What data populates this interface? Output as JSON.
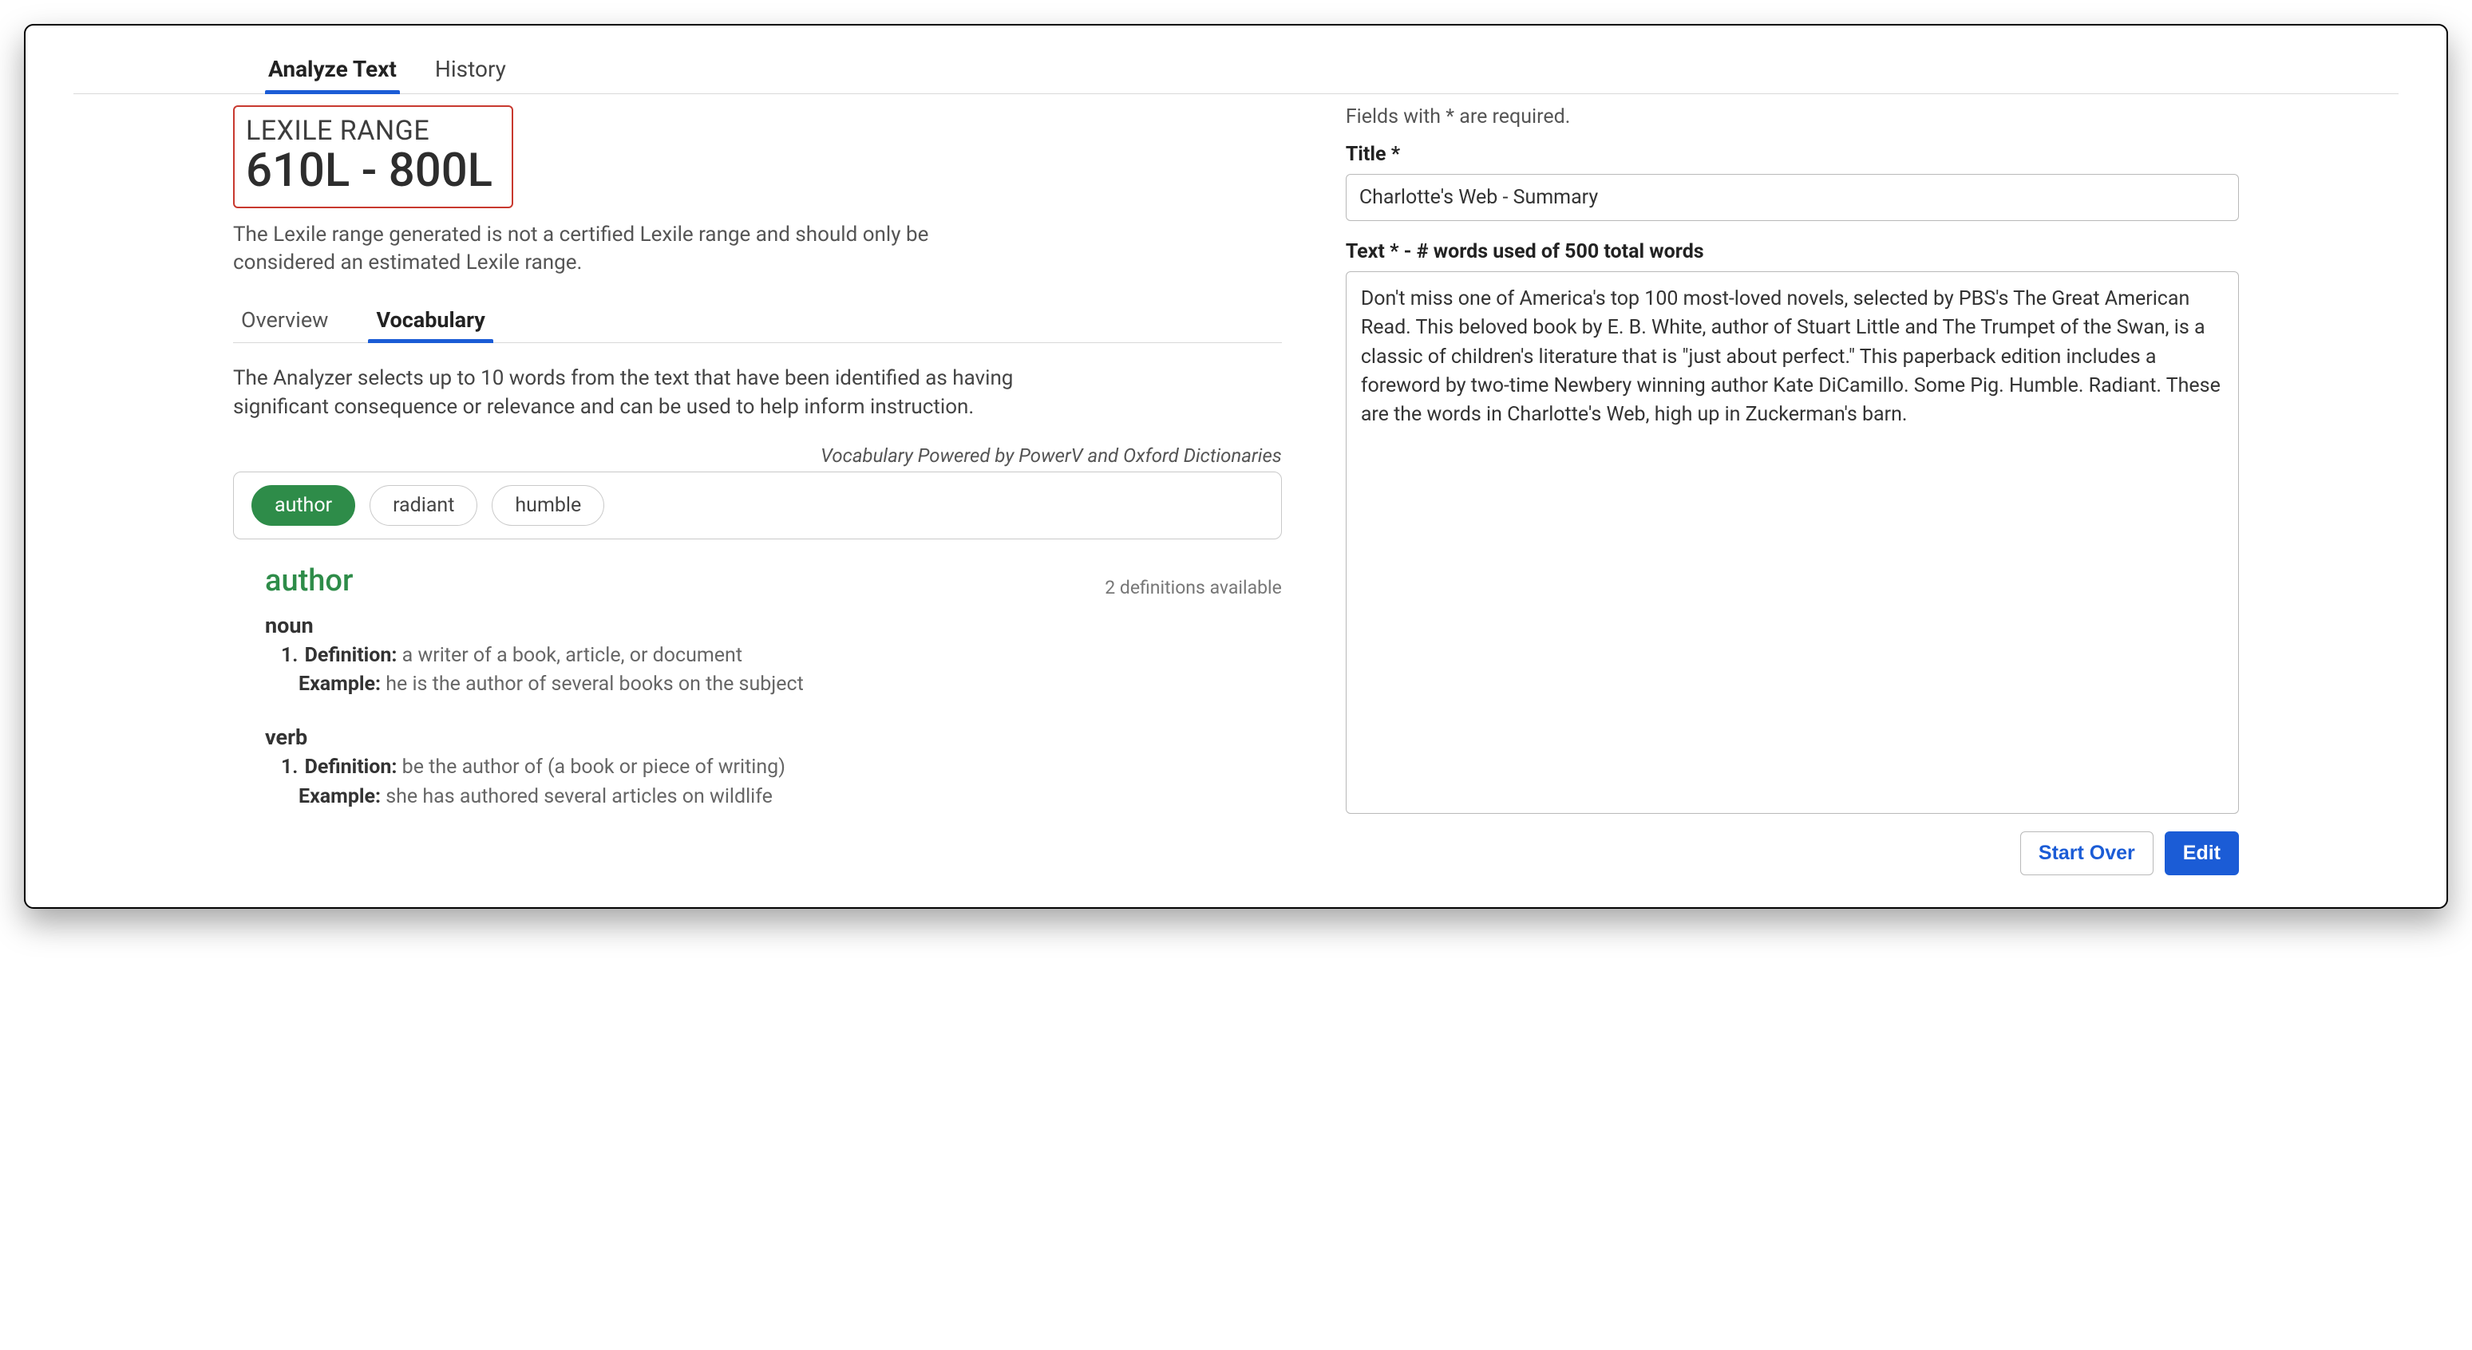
{
  "tabs": {
    "analyze": "Analyze Text",
    "history": "History"
  },
  "lexile": {
    "label": "LEXILE RANGE",
    "value": "610L - 800L",
    "note": "The Lexile range generated is not a certified Lexile range and should only be considered an estimated Lexile range."
  },
  "subtabs": {
    "overview": "Overview",
    "vocabulary": "Vocabulary"
  },
  "analyzer_desc": "The Analyzer selects up to 10 words from the text that have been identified as having significant consequence or relevance and can be used to help inform instruction.",
  "powered_by": "Vocabulary Powered by PowerV and Oxford Dictionaries",
  "chips": {
    "author": "author",
    "radiant": "radiant",
    "humble": "humble"
  },
  "definition": {
    "word": "author",
    "count_text": "2 definitions available",
    "pos1": {
      "label": "noun",
      "num": "1.",
      "def_label": "Definition:",
      "def_text": "a writer of a book, article, or document",
      "ex_label": "Example:",
      "ex_text": "he is the author of several books on the subject"
    },
    "pos2": {
      "label": "verb",
      "num": "1.",
      "def_label": "Definition:",
      "def_text": "be the author of (a book or piece of writing)",
      "ex_label": "Example:",
      "ex_text": "she has authored several articles on wildlife"
    }
  },
  "right": {
    "required_note": "Fields with * are required.",
    "title_label": "Title *",
    "title_value": "Charlotte's Web - Summary",
    "text_label": "Text * -  # words used of 500 total words",
    "text_value": "Don't miss one of America's top 100 most-loved novels, selected by PBS's The Great American Read. This beloved book by E. B. White, author of Stuart Little and The Trumpet of the Swan, is a classic of children's literature that is \"just about perfect.\" This paperback edition includes a foreword by two-time Newbery winning author Kate DiCamillo. Some Pig. Humble. Radiant. These are the words in Charlotte's Web, high up in Zuckerman's barn.",
    "start_over": "Start Over",
    "edit": "Edit"
  }
}
